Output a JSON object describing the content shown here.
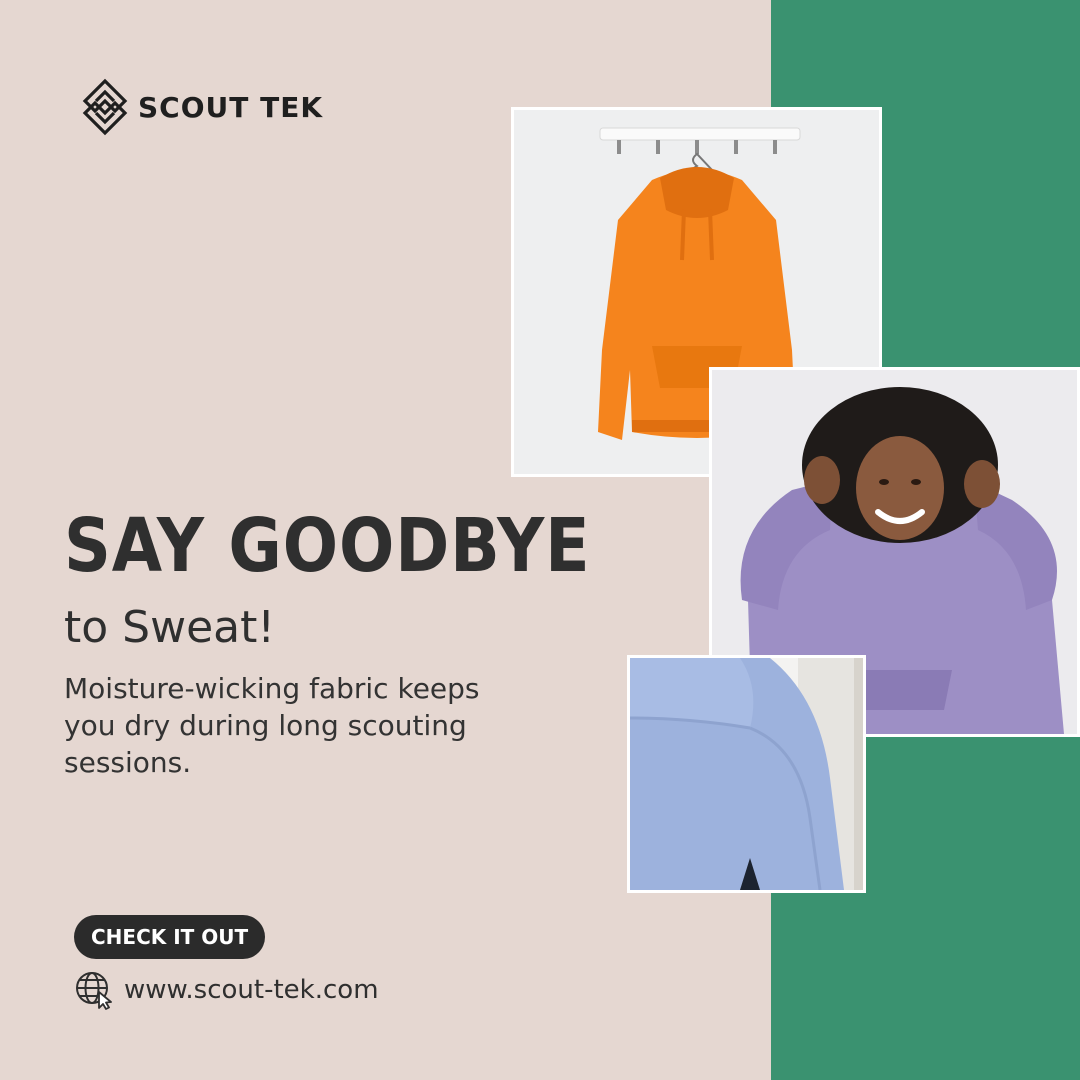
{
  "brand": {
    "name": "SCOUT TEK"
  },
  "headline": "SAY GOODBYE",
  "subheadline": "to Sweat!",
  "body": "Moisture-wicking fabric keeps you dry during long scouting sessions.",
  "cta": {
    "label": "CHECK IT OUT"
  },
  "website": "www.scout-tek.com",
  "icons": {
    "logo": "scout-tek-logo-icon",
    "web": "globe-cursor-icon"
  },
  "colors": {
    "background": "#e5d7d1",
    "accent_green": "#3a9270",
    "text_dark": "#2e2e2e",
    "button_bg": "#2b2b2b",
    "hoodie_orange": "#f5841d",
    "hoodie_purple": "#9d8fc5",
    "hoodie_blue": "#9db2dd"
  }
}
